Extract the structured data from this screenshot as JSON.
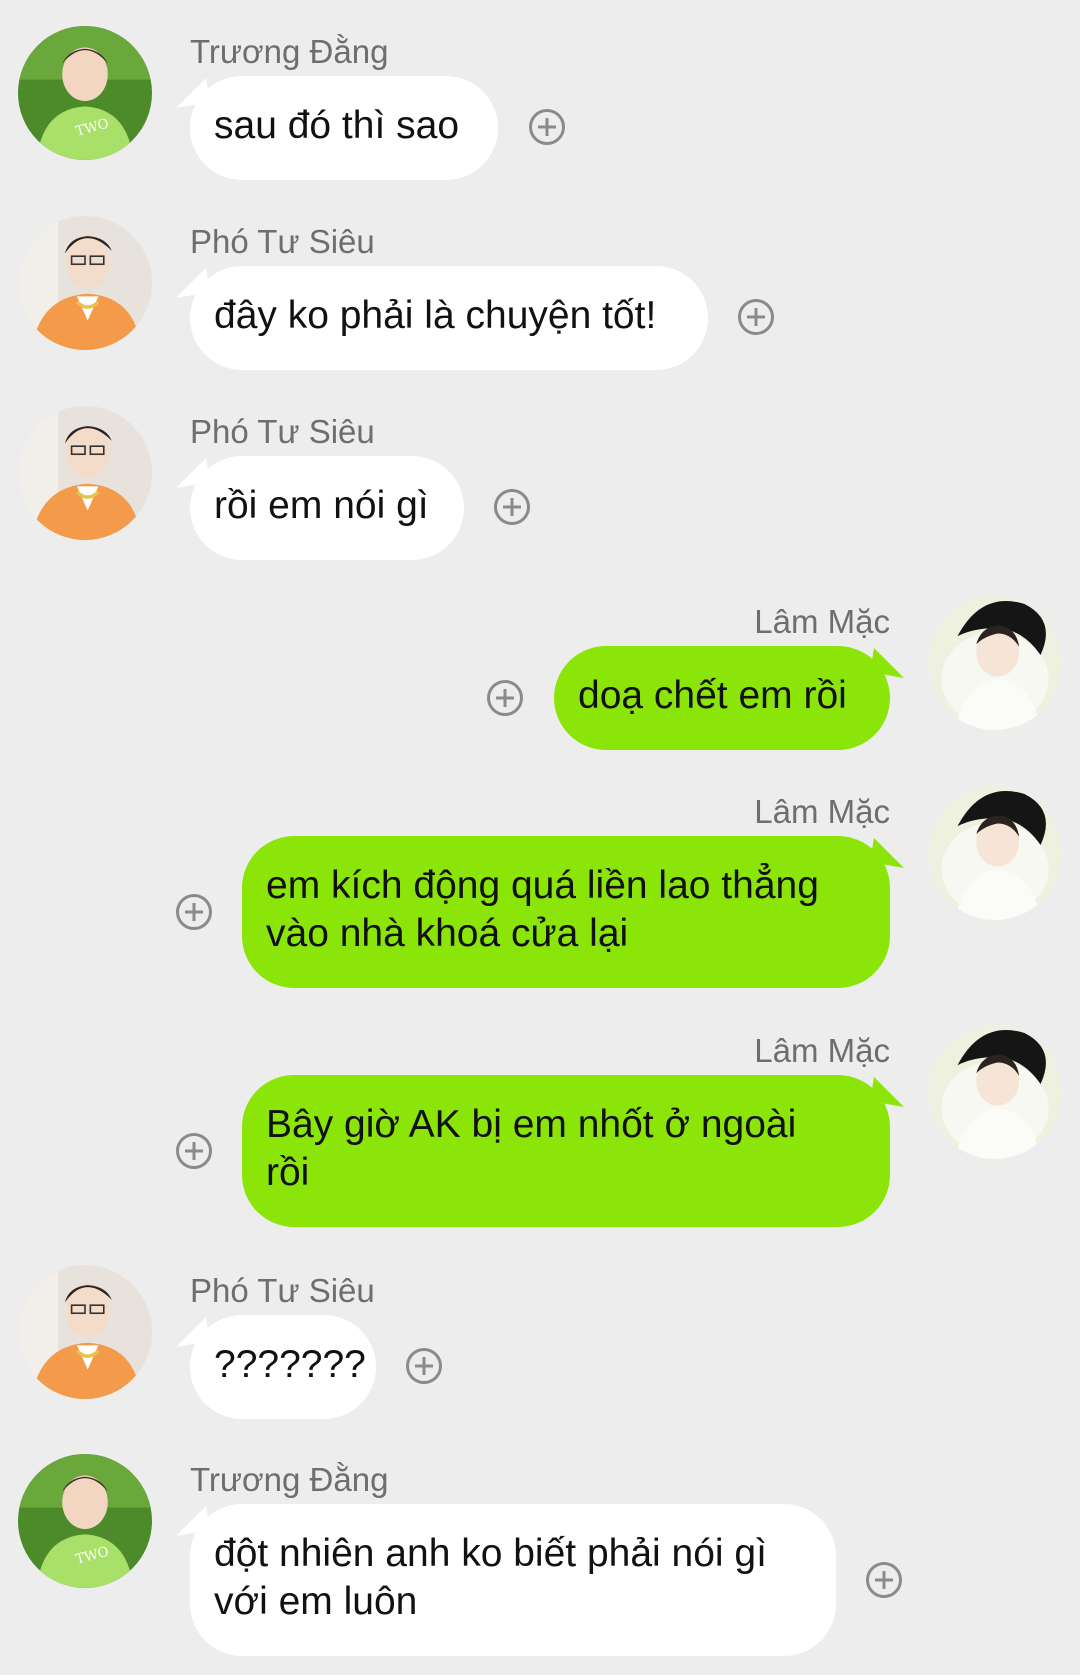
{
  "colors": {
    "background": "#ededed",
    "incoming_bubble": "#ffffff",
    "outgoing_bubble": "#8be508",
    "name_text": "#6e6e6e"
  },
  "messages": [
    {
      "sender": "Trương Đằng",
      "side": "left",
      "avatar": "avatar-green-shirt",
      "text": "sau đó thì sao",
      "action_icon": "plus-circle-icon"
    },
    {
      "sender": "Phó Tư Siêu",
      "side": "left",
      "avatar": "avatar-orange-shirt",
      "text": "đây ko phải là chuyện tốt!",
      "action_icon": "plus-circle-icon"
    },
    {
      "sender": "Phó Tư Siêu",
      "side": "left",
      "avatar": "avatar-orange-shirt",
      "text": "rồi em nói gì",
      "action_icon": "plus-circle-icon"
    },
    {
      "sender": "Lâm Mặc",
      "side": "right",
      "avatar": "avatar-black-hat",
      "text": "doạ chết em rồi",
      "action_icon": "plus-circle-icon"
    },
    {
      "sender": "Lâm Mặc",
      "side": "right",
      "avatar": "avatar-black-hat",
      "text_lines": [
        "em kích động quá liền lao thẳng",
        "vào nhà khoá cửa lại"
      ],
      "action_icon": "plus-circle-icon"
    },
    {
      "sender": "Lâm Mặc",
      "side": "right",
      "avatar": "avatar-black-hat",
      "text_lines": [
        "Bây giờ AK bị em nhốt ở ngoài",
        "rồi"
      ],
      "action_icon": "plus-circle-icon"
    },
    {
      "sender": "Phó Tư Siêu",
      "side": "left",
      "avatar": "avatar-orange-shirt",
      "text": "???????",
      "action_icon": "plus-circle-icon"
    },
    {
      "sender": "Trương Đằng",
      "side": "left",
      "avatar": "avatar-green-shirt",
      "text_lines": [
        "đột nhiên anh ko biết phải nói gì",
        "với em luôn"
      ],
      "action_icon": "plus-circle-icon"
    }
  ]
}
